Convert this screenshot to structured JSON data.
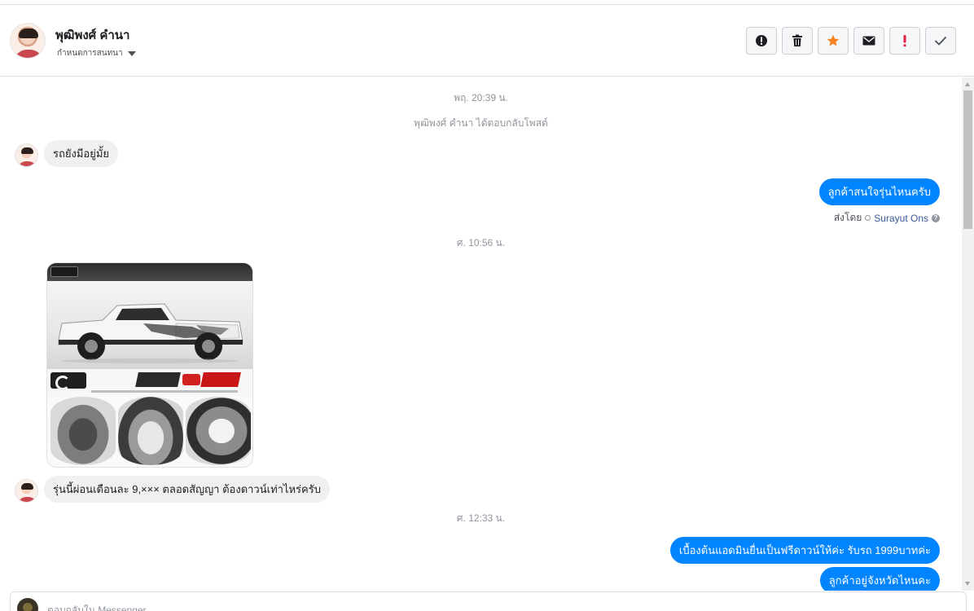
{
  "header": {
    "contact_name": "พุฒิพงศ์ คำนา",
    "assign_label": "กำหนดการสนทนา",
    "toolbar": [
      {
        "name": "spam-button",
        "icon": "alert-circle-icon"
      },
      {
        "name": "delete-button",
        "icon": "trash-icon"
      },
      {
        "name": "star-button",
        "icon": "star-icon"
      },
      {
        "name": "mark-unread-button",
        "icon": "envelope-icon"
      },
      {
        "name": "follow-up-button",
        "icon": "exclamation-icon"
      },
      {
        "name": "done-button",
        "icon": "check-icon"
      }
    ]
  },
  "thread": {
    "timestamp_1": "พฤ. 20:39 น.",
    "system_note": "พุฒิพงศ์ คำนา ได้ตอบกลับโพสต์",
    "msg_in_1": "รถยังมีอยู่มั้ย",
    "msg_out_1": "ลูกค้าสนใจรุ่นไหนครับ",
    "sent_by_label": "ส่งโดย",
    "sent_by_agent": "Surayut Ons",
    "timestamp_2": "ศ. 10:56 น.",
    "msg_in_2": "รุ่นนี้ผ่อนเดือนละ 9,××× ตลอดสัญญา ต้องดาวน์เท่าไหร่ครับ",
    "timestamp_3": "ศ. 12:33 น.",
    "msg_out_2": "เบื้องต้นแอดมินยื่นเป็นฟรีดาวน์ให้ค่ะ รับรถ 1999บาทค่ะ",
    "msg_out_3": "ลูกค้าอยู่จังหวัดไหนคะ"
  },
  "composer": {
    "placeholder": "ตอบกลับใน Messenger..."
  },
  "colors": {
    "outgoing_bubble": "#0084ff",
    "incoming_bubble": "#f1f0f0",
    "star": "#f5821f",
    "follow_up": "#e41e3f"
  }
}
